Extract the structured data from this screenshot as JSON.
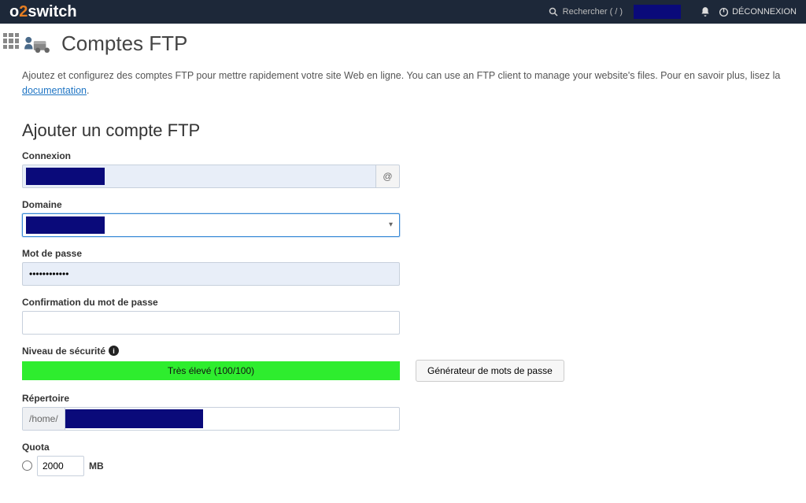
{
  "top": {
    "brand_o": "o",
    "brand_2": "2",
    "brand_switch": "switch",
    "search_placeholder": "Rechercher ( / )",
    "logout": "DÉCONNEXION"
  },
  "page": {
    "title": "Comptes FTP",
    "intro_pre": "Ajoutez et configurez des comptes FTP pour mettre rapidement votre site Web en ligne. You can use an FTP client to manage your website's files. Pour en savoir plus, lisez la ",
    "intro_link": "documentation",
    "intro_post": "."
  },
  "form": {
    "heading": "Ajouter un compte FTP",
    "login_label": "Connexion",
    "at_symbol": "@",
    "domain_label": "Domaine",
    "password_label": "Mot de passe",
    "password_value": "••••••••••••",
    "confirm_label": "Confirmation du mot de passe",
    "strength_label": "Niveau de sécurité",
    "strength_text": "Très élevé (100/100)",
    "generator_btn": "Générateur de mots de passe",
    "directory_label": "Répertoire",
    "directory_prefix": "/home/",
    "quota_label": "Quota",
    "quota_value": "2000",
    "quota_unit": "MB"
  }
}
